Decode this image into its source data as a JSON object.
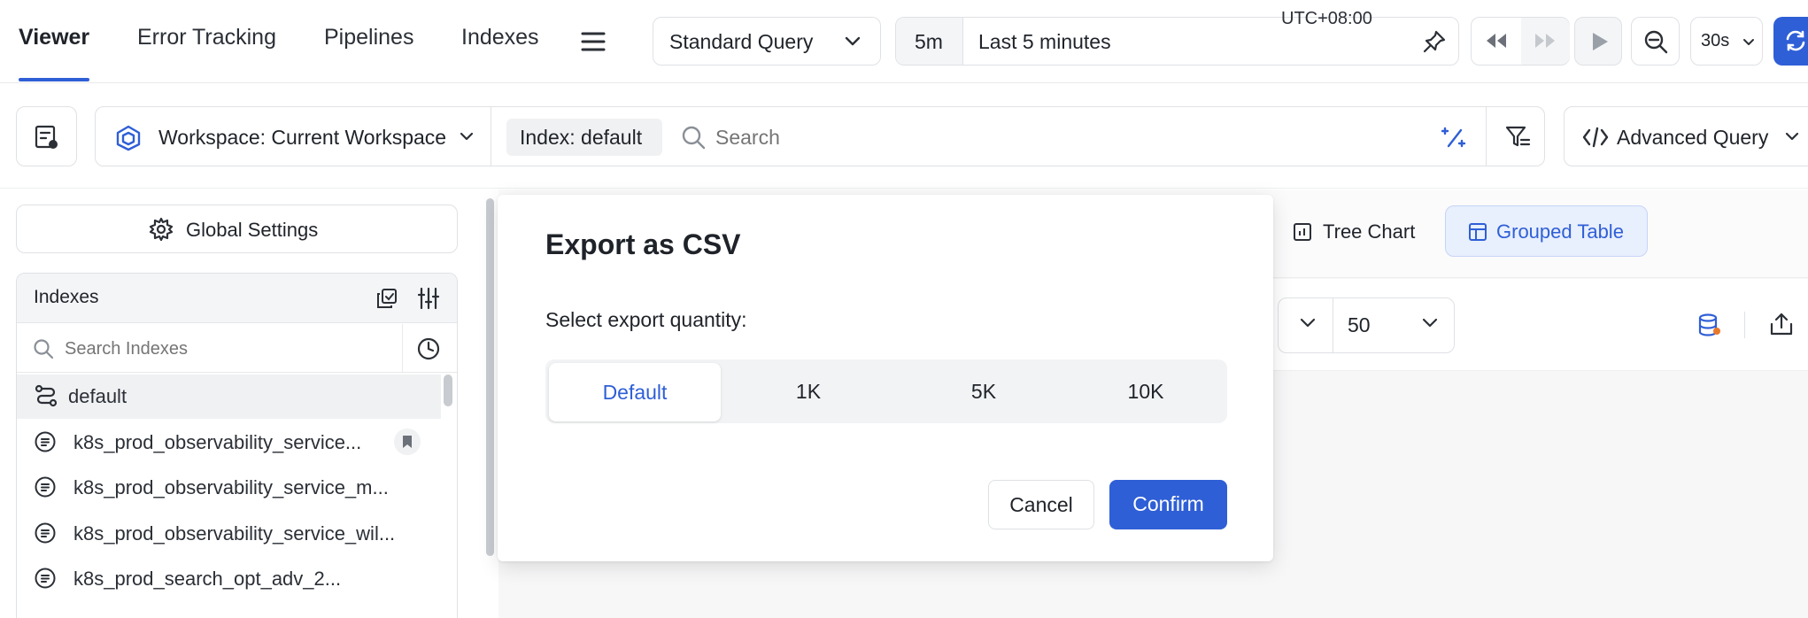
{
  "nav": {
    "tabs": [
      {
        "label": "Viewer",
        "active": true
      },
      {
        "label": "Error Tracking"
      },
      {
        "label": "Pipelines"
      },
      {
        "label": "Indexes"
      }
    ]
  },
  "query_mode": {
    "selected": "Standard Query"
  },
  "time_range": {
    "short": "5m",
    "label": "Last 5 minutes",
    "timezone": "UTC+08:00"
  },
  "refresh": {
    "interval": "30s"
  },
  "search_bar": {
    "workspace": "Workspace: Current Workspace",
    "index_chip": "Index: default",
    "placeholder": "Search",
    "advanced_query": "Advanced Query"
  },
  "sidebar": {
    "global_settings": "Global Settings",
    "indexes_title": "Indexes",
    "search_placeholder": "Search Indexes",
    "items": [
      {
        "label": "default",
        "selected": true
      },
      {
        "label": "k8s_prod_observability_service..."
      },
      {
        "label": "k8s_prod_observability_service_m..."
      },
      {
        "label": "k8s_prod_observability_service_wil..."
      },
      {
        "label": "k8s_prod_search_opt_adv_2..."
      }
    ]
  },
  "view_tabs": {
    "tree_chart": "Tree Chart",
    "grouped_table": "Grouped Table"
  },
  "page_size": {
    "value": "50"
  },
  "modal": {
    "title": "Export as CSV",
    "prompt": "Select export quantity:",
    "options": [
      "Default",
      "1K",
      "5K",
      "10K"
    ],
    "selected": "Default",
    "cancel": "Cancel",
    "confirm": "Confirm"
  },
  "colors": {
    "accent": "#2f5fd6",
    "selected_tab_bg": "#e8effd",
    "modal_overlay_bg": "#f7f7f8"
  }
}
